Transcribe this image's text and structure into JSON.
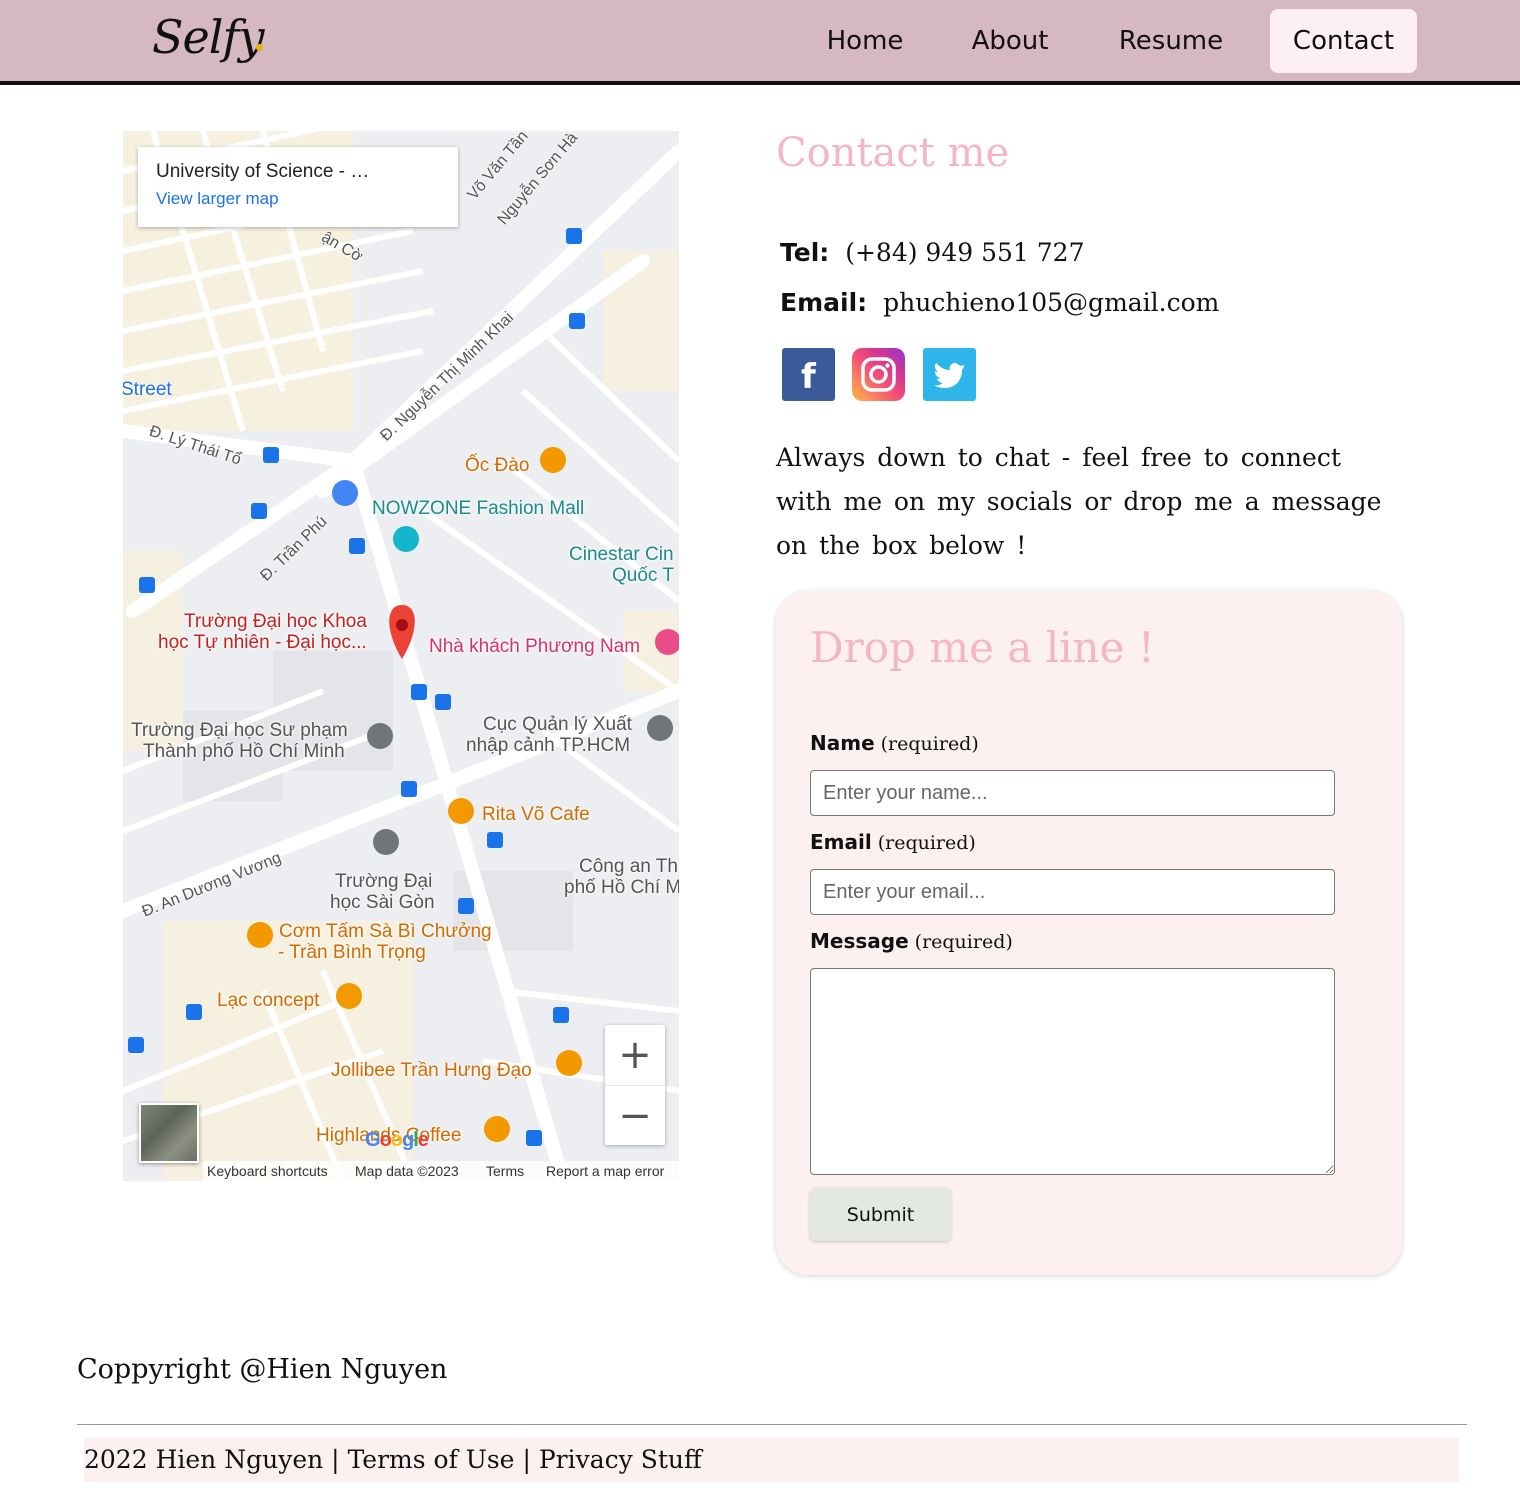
{
  "header": {
    "logo": "Selfy",
    "nav": [
      {
        "label": "Home"
      },
      {
        "label": "About"
      },
      {
        "label": "Resume"
      },
      {
        "label": "Contact"
      }
    ],
    "active_nav": "Contact",
    "colors": {
      "header_bg": "#d5b8c0",
      "active_tab_bg": "#fdf0f2"
    }
  },
  "map": {
    "card_title": "University of Science - …",
    "card_link": "View larger map",
    "labels": {
      "street": "Street",
      "ly_thai_to": "Đ. Lý Thái Tổ",
      "vo_van_tan": "Võ Văn Tần",
      "nguyen_son_ha": "Nguyễn Sơn Hà",
      "ban_co": "ận Cờ",
      "nguyen_thi_minh_khai": "Đ. Nguyễn Thị Minh Khai",
      "tran_phu": "Đ. Trần Phú",
      "oc_dao": "Ốc Đào",
      "nowzone": "NOWZONE Fashion Mall",
      "cinestar_1": "Cinestar Cin",
      "cinestar_2": "Quốc T",
      "truong_dh_1": "Trường Đại học Khoa",
      "truong_dh_2": "học Tự nhiên - Đại học...",
      "nha_khach": "Nhà khách Phương Nam",
      "su_pham_1": "Trường Đại học Sư phạm",
      "su_pham_2": "Thành phố Hồ Chí Minh",
      "cuc_quan_ly_1": "Cục Quản lý Xuất",
      "cuc_quan_ly_2": "nhập cảnh TP.HCM",
      "rita": "Rita Võ Cafe",
      "cong_an_1": "Công an Th",
      "cong_an_2": "phố Hồ Chí M",
      "an_duong_vuong": "Đ. An Dương Vương",
      "sai_gon_1": "Trường Đại",
      "sai_gon_2": "học Sài Gòn",
      "com_tam_1": "Cơm Tấm Sà Bì Chưởng",
      "com_tam_2": "- Trần Bình Trọng",
      "lac_concept": "Lạc concept",
      "jollibee": "Jollibee Trần Hưng Đạo",
      "highlands": "Highlands Coffee",
      "google": "Google"
    },
    "zoom_in": "+",
    "zoom_out": "−",
    "footer": {
      "shortcuts": "Keyboard shortcuts",
      "map_data": "Map data ©2023",
      "terms": "Terms",
      "report": "Report a map error"
    }
  },
  "contact": {
    "title": "Contact me",
    "tel_label": "Tel:",
    "tel_value": "(+84) 949 551 727",
    "email_label": "Email:",
    "email_value": "phuchieno105@gmail.com",
    "socials": [
      {
        "name": "facebook",
        "glyph": "f"
      },
      {
        "name": "instagram",
        "glyph": "◎"
      },
      {
        "name": "twitter",
        "glyph": "🐦"
      }
    ],
    "tagline": "Always down to chat - feel free to connect with me on my socials or drop me a message on the box below !"
  },
  "form": {
    "title": "Drop me a line !",
    "name_label": "Name",
    "name_req": "(required)",
    "name_placeholder": "Enter your name...",
    "email_label": "Email",
    "email_req": "(required)",
    "email_placeholder": "Enter your email...",
    "message_label": "Message",
    "message_req": "(required)",
    "submit": "Submit",
    "colors": {
      "card_bg": "#fdf0f1",
      "title": "#f4b6c4",
      "submit_bg": "#e3e8e2"
    }
  },
  "footer": {
    "copyright": "Coppyright @Hien Nguyen",
    "year_name": "2022 Hien Nguyen",
    "sep": "|",
    "terms": "Terms of Use",
    "privacy": "Privacy Stuff"
  }
}
